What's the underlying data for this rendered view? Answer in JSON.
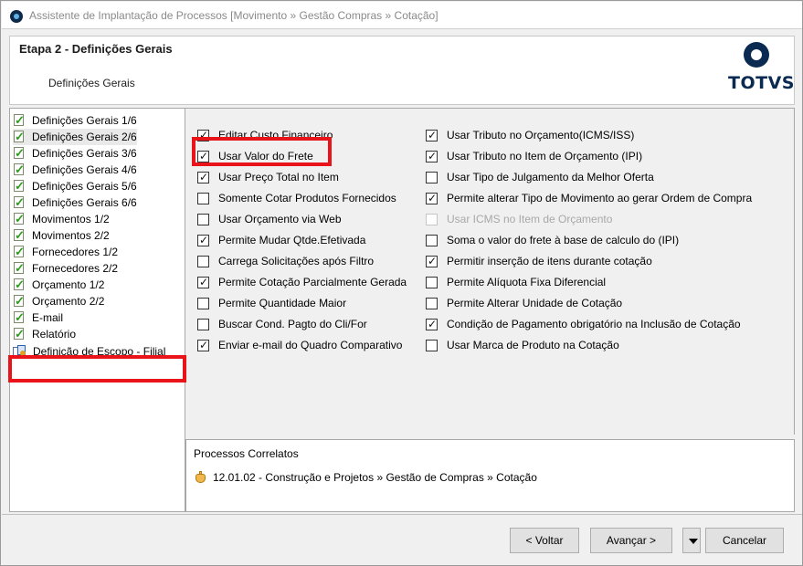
{
  "window": {
    "title": "Assistente de Implantação de Processos [Movimento » Gestão Compras » Cotação]"
  },
  "header": {
    "step_title": "Etapa 2 - Definições Gerais",
    "step_subtitle": "Definições Gerais",
    "logo_text": "TOTVS"
  },
  "sidebar": {
    "items": [
      {
        "label": "Definições Gerais 1/6"
      },
      {
        "label": "Definições Gerais 2/6"
      },
      {
        "label": "Definições Gerais 3/6"
      },
      {
        "label": "Definições Gerais 4/6"
      },
      {
        "label": "Definições Gerais 5/6"
      },
      {
        "label": "Definições Gerais 6/6"
      },
      {
        "label": "Movimentos 1/2"
      },
      {
        "label": "Movimentos 2/2"
      },
      {
        "label": "Fornecedores 1/2"
      },
      {
        "label": "Fornecedores 2/2"
      },
      {
        "label": "Orçamento 1/2"
      },
      {
        "label": "Orçamento 2/2"
      },
      {
        "label": "E-mail"
      },
      {
        "label": "Relatório"
      },
      {
        "label": "Definição de Escopo - Filial"
      }
    ]
  },
  "options": {
    "left": [
      {
        "label": "Editar Custo Financeiro",
        "checked": true
      },
      {
        "label": "Usar Valor do Frete",
        "checked": true
      },
      {
        "label": "Usar Preço Total no Item",
        "checked": true
      },
      {
        "label": "Somente Cotar Produtos Fornecidos",
        "checked": false
      },
      {
        "label": "Usar Orçamento via Web",
        "checked": false
      },
      {
        "label": "Permite Mudar Qtde.Efetivada",
        "checked": true
      },
      {
        "label": "Carrega Solicitações após Filtro",
        "checked": false
      },
      {
        "label": "Permite Cotação Parcialmente Gerada",
        "checked": true
      },
      {
        "label": "Permite Quantidade Maior",
        "checked": false
      },
      {
        "label": "Buscar Cond. Pagto do Cli/For",
        "checked": false
      },
      {
        "label": "Enviar e-mail do Quadro Comparativo",
        "checked": true
      }
    ],
    "right": [
      {
        "label": "Usar Tributo no Orçamento(ICMS/ISS)",
        "checked": true
      },
      {
        "label": "Usar Tributo no Item de Orçamento (IPI)",
        "checked": true
      },
      {
        "label": "Usar Tipo de Julgamento da Melhor Oferta",
        "checked": false
      },
      {
        "label": "Permite alterar Tipo de Movimento ao gerar Ordem de Compra",
        "checked": true
      },
      {
        "label": "Usar ICMS no Item de Orçamento",
        "checked": false,
        "disabled": true
      },
      {
        "label": "Soma o valor do frete à base de calculo do (IPI)",
        "checked": false
      },
      {
        "label": "Permitir inserção de itens durante cotação",
        "checked": true
      },
      {
        "label": "Permite Alíquota Fixa Diferencial",
        "checked": false
      },
      {
        "label": "Permite Alterar Unidade de Cotação",
        "checked": false
      },
      {
        "label": "Condição de Pagamento obrigatório na Inclusão de Cotação",
        "checked": true
      },
      {
        "label": "Usar Marca de Produto na Cotação",
        "checked": false
      }
    ]
  },
  "correlatos": {
    "title": "Processos Correlatos",
    "link": "12.01.02 - Construção e Projetos » Gestão de Compras » Cotação"
  },
  "footer": {
    "back": "< Voltar",
    "next": "Avançar >",
    "cancel": "Cancelar"
  },
  "colors": {
    "highlight_red": "#e8141a",
    "logo_blue": "#0b2a52"
  }
}
